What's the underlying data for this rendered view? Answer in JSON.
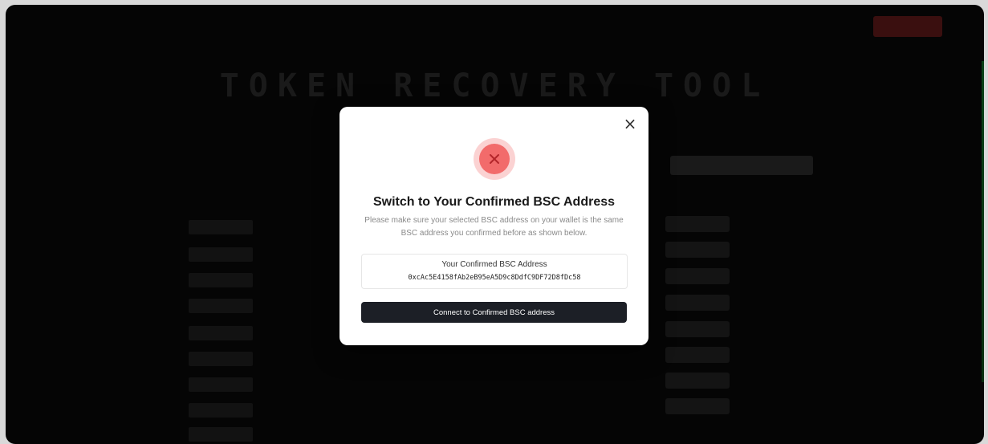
{
  "modal": {
    "title": "Switch to Your Confirmed BSC Address",
    "description": "Please make sure your selected BSC address on your wallet is the same BSC address you confirmed before as shown below.",
    "address_label": "Your Confirmed BSC Address",
    "address_value": "0xcAc5E4158fAb2eB95eA5D9c8DdfC9DF72D8fDc58",
    "connect_button": "Connect to Confirmed BSC address",
    "close_symbol": "×",
    "status_icon": "error-x-icon",
    "colors": {
      "icon_outer": "#fbd2d2",
      "icon_inner": "#f26b6b",
      "button_bg": "#1c1f26"
    }
  },
  "background": {
    "hero_title": "TOKEN RECOVERY TOOL"
  }
}
